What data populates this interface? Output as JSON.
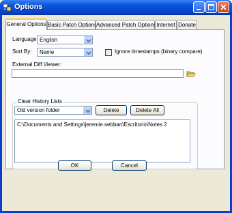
{
  "window": {
    "title": "Options"
  },
  "tabs": [
    {
      "label": "General Options"
    },
    {
      "label": "Basic Patch Options"
    },
    {
      "label": "Advanced Patch Options"
    },
    {
      "label": "Internet"
    },
    {
      "label": "Donate"
    }
  ],
  "general": {
    "language_label": "Language:",
    "language_value": "English",
    "sortby_label": "Sort By:",
    "sortby_value": "Name",
    "ignore_timestamps_label": "Ignore timestamps (binary compare)",
    "ignore_timestamps_checked": false,
    "external_diff_label": "External Diff Viewer:",
    "external_diff_value": ""
  },
  "history": {
    "group_label": "Clear History Lists",
    "list_selected": "Old version folder",
    "delete_label": "Delete",
    "delete_all_label": "Delete All",
    "items": [
      "C:\\Documents and Settings\\jeremie.sebban\\Escritorio\\Notes 2"
    ]
  },
  "footer": {
    "ok_label": "OK",
    "cancel_label": "Cancel"
  },
  "icons": {
    "folder": "folder-open-icon",
    "dropdown": "chevron-down-icon",
    "minimize": "minimize-icon",
    "maximize": "maximize-icon",
    "close": "close-icon"
  },
  "colors": {
    "titlebar": "#0a55e0",
    "tab_highlight": "#ffc83c",
    "close_button": "#c8401c"
  }
}
